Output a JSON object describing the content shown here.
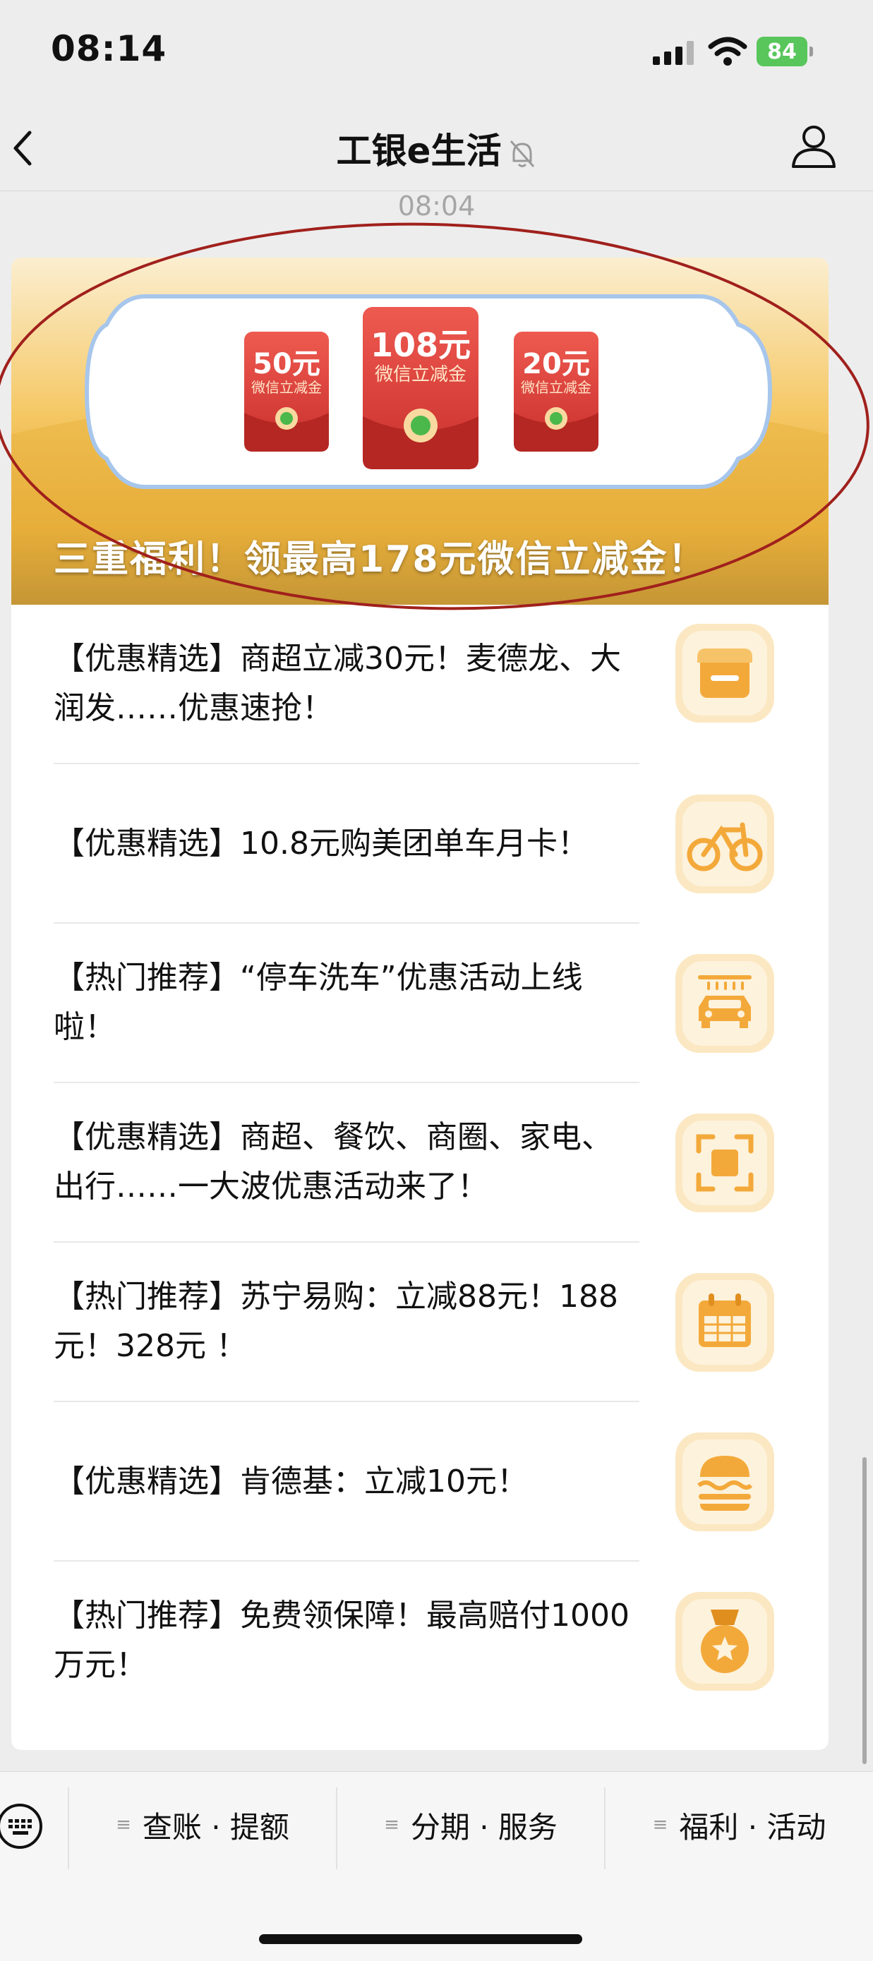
{
  "status": {
    "time": "08:14",
    "battery": "84"
  },
  "nav": {
    "title": "工银e生活"
  },
  "chat": {
    "timestamp": "08:04"
  },
  "banner": {
    "headline": "三重福利！领最高178元微信立减金！",
    "packets": [
      {
        "amount": "50元",
        "label": "微信立减金"
      },
      {
        "amount": "108元",
        "label": "微信立减金"
      },
      {
        "amount": "20元",
        "label": "微信立减金"
      }
    ]
  },
  "items": [
    {
      "text": "【优惠精选】商超立减30元！麦德龙、大润发……优惠速抢！",
      "icon": "store-icon"
    },
    {
      "text": "【优惠精选】10.8元购美团单车月卡！",
      "icon": "bicycle-icon"
    },
    {
      "text": "【热门推荐】“停车洗车”优惠活动上线啦！",
      "icon": "car-wash-icon"
    },
    {
      "text": "【优惠精选】商超、餐饮、商圈、家电、出行……一大波优惠活动来了！",
      "icon": "scan-icon"
    },
    {
      "text": "【热门推荐】苏宁易购：立减88元！188元！328元 ！",
      "icon": "calendar-icon"
    },
    {
      "text": "【优惠精选】肯德基：立减10元！",
      "icon": "burger-icon"
    },
    {
      "text": "【热门推荐】免费领保障！最高赔付1000万元！",
      "icon": "medal-icon"
    }
  ],
  "menu": [
    {
      "label": "查账 · 提额"
    },
    {
      "label": "分期 · 服务"
    },
    {
      "label": "福利 · 活动"
    }
  ],
  "colors": {
    "accent": "#f5a623",
    "packet": "#e2433f",
    "annotation": "#a0201c"
  }
}
